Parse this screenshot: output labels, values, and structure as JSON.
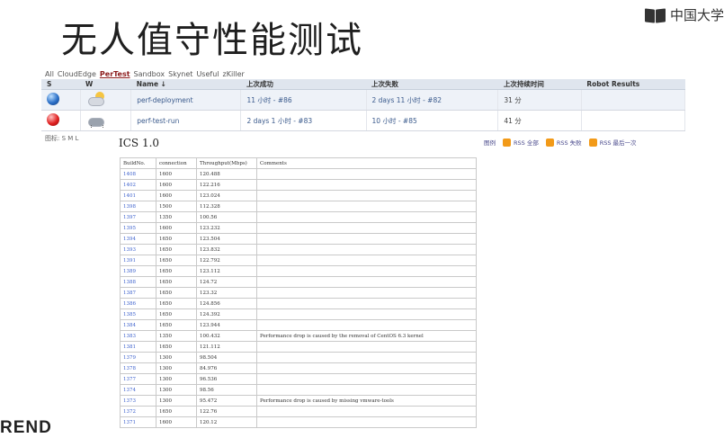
{
  "slide": {
    "title": "无人值守性能测试"
  },
  "logo": {
    "text": "中国大学"
  },
  "view_tabs": [
    "All",
    "CloudEdge",
    "PerTest",
    "Sandbox",
    "Skynet",
    "Useful",
    "zKiller"
  ],
  "active_tab_index": 2,
  "jobs_table": {
    "headers": [
      "S",
      "W",
      "Name ↓",
      "上次成功",
      "上次失败",
      "上次持续时间",
      "Robot Results"
    ],
    "rows": [
      {
        "status": "blue",
        "weather": "sun-cloud",
        "name": "perf-deployment",
        "last_success": "11 小时 - #86",
        "last_failure": "2 days 11 小时 - #82",
        "duration": "31 分"
      },
      {
        "status": "red",
        "weather": "storm",
        "name": "perf-test-run",
        "last_success": "2 days 1 小时 - #83",
        "last_failure": "10 小时 - #85",
        "duration": "41 分"
      }
    ]
  },
  "icon_legend": "图标: S M L",
  "section_title": "ICS 1.0",
  "rss": {
    "legend": "图例",
    "all": "RSS 全部",
    "failures": "RSS 失败",
    "latest": "RSS 最后一次"
  },
  "perf_table": {
    "headers": [
      "BuildNo.",
      "connection",
      "Throughput(Mbps)",
      "Comments"
    ],
    "rows": [
      [
        "1408",
        "1600",
        "120.488",
        ""
      ],
      [
        "1402",
        "1600",
        "122.216",
        ""
      ],
      [
        "1401",
        "1600",
        "123.024",
        ""
      ],
      [
        "1398",
        "1500",
        "112.328",
        ""
      ],
      [
        "1397",
        "1350",
        "100.56",
        ""
      ],
      [
        "1395",
        "1600",
        "123.232",
        ""
      ],
      [
        "1394",
        "1650",
        "123.504",
        ""
      ],
      [
        "1393",
        "1650",
        "123.832",
        ""
      ],
      [
        "1391",
        "1650",
        "122.792",
        ""
      ],
      [
        "1389",
        "1650",
        "123.112",
        ""
      ],
      [
        "1388",
        "1650",
        "124.72",
        ""
      ],
      [
        "1387",
        "1650",
        "123.32",
        ""
      ],
      [
        "1386",
        "1650",
        "124.856",
        ""
      ],
      [
        "1385",
        "1650",
        "124.392",
        ""
      ],
      [
        "1384",
        "1650",
        "123.944",
        ""
      ],
      [
        "1383",
        "1350",
        "100.432",
        "Performance drop is caused by the removal of CentOS 6.3 kernel"
      ],
      [
        "1381",
        "1650",
        "121.112",
        ""
      ],
      [
        "1379",
        "1300",
        "98.504",
        ""
      ],
      [
        "1378",
        "1300",
        "84.976",
        ""
      ],
      [
        "1377",
        "1300",
        "96.536",
        ""
      ],
      [
        "1374",
        "1300",
        "98.56",
        ""
      ],
      [
        "1373",
        "1300",
        "95.472",
        "Performance drop is caused by missing vmware-tools"
      ],
      [
        "1372",
        "1650",
        "122.76",
        ""
      ],
      [
        "1371",
        "1600",
        "120.12",
        ""
      ]
    ]
  },
  "footer_text": "REND",
  "colors": {
    "link": "#3a5a8c",
    "build_link": "#3a5fcc",
    "header_bg": "#dfe5ee",
    "active_tab": "#8b1a1a",
    "rss": "#f29a18"
  }
}
